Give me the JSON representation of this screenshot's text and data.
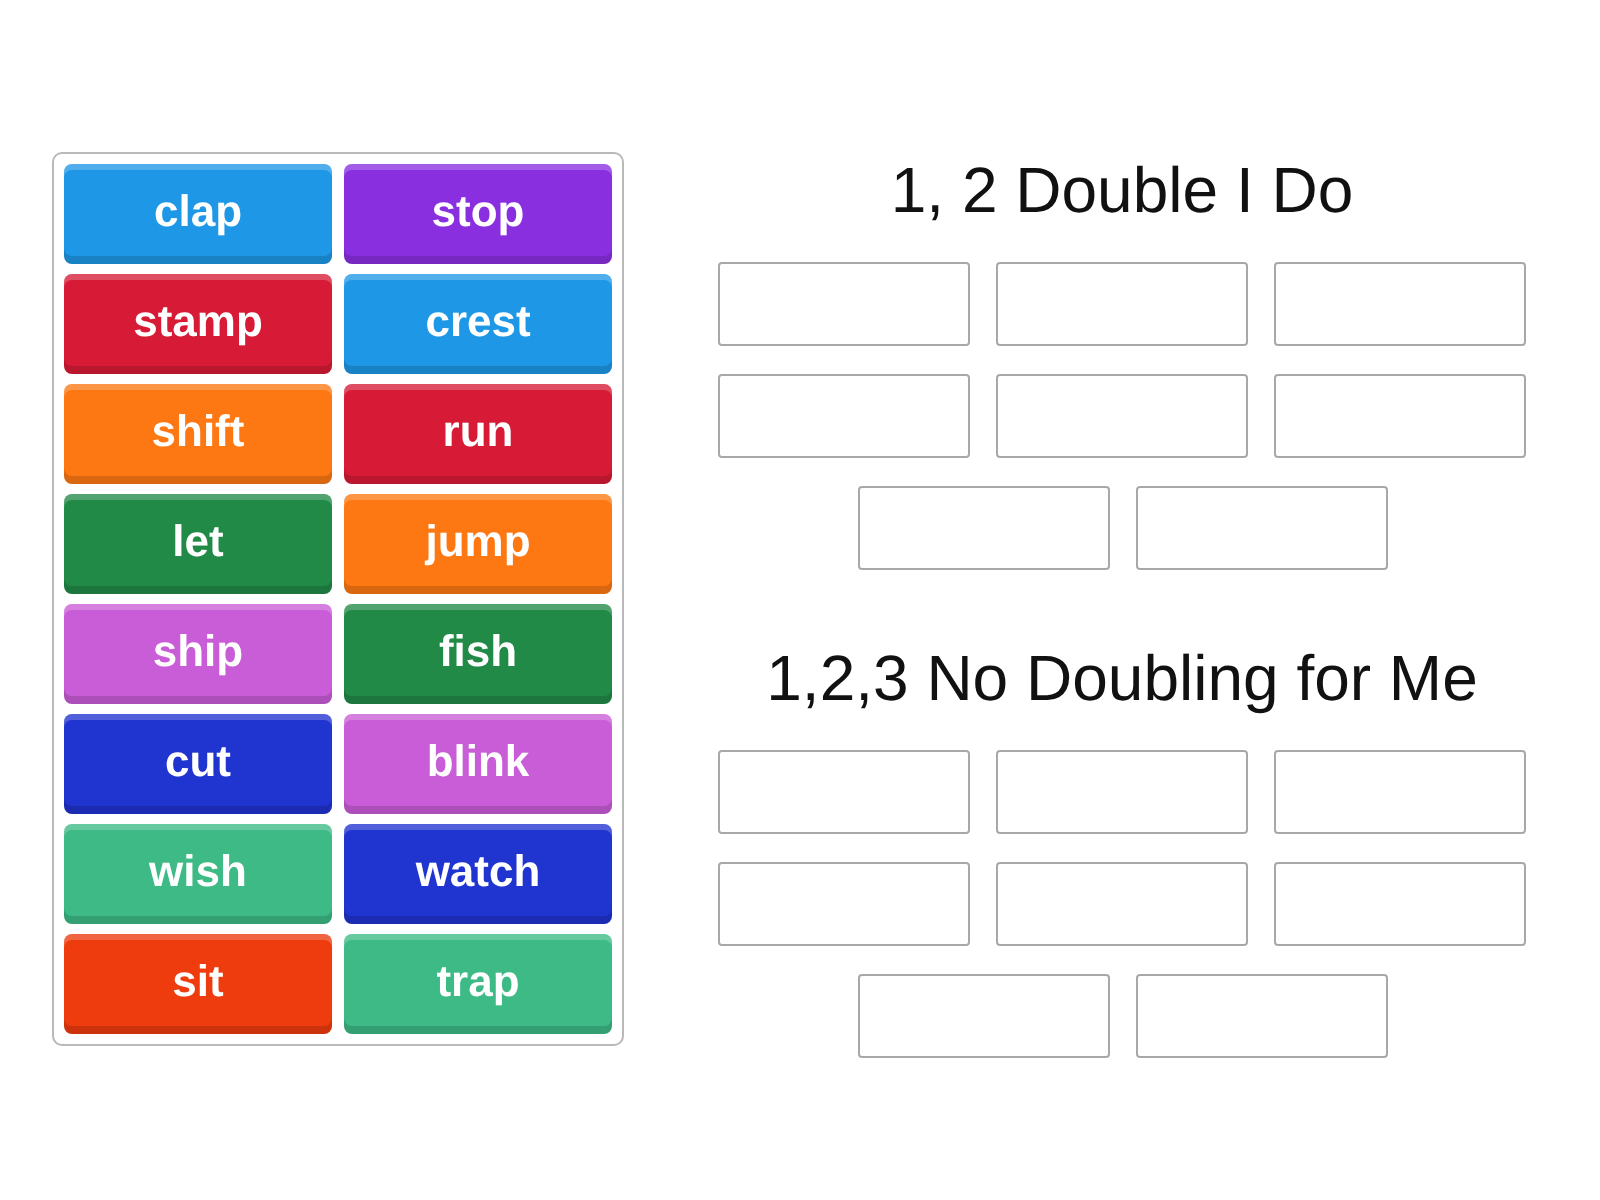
{
  "tiles": [
    {
      "word": "clap",
      "color": "#1e98e6"
    },
    {
      "word": "stop",
      "color": "#8a2fe0"
    },
    {
      "word": "stamp",
      "color": "#d71b36"
    },
    {
      "word": "crest",
      "color": "#1e98e6"
    },
    {
      "word": "shift",
      "color": "#fd7812"
    },
    {
      "word": "run",
      "color": "#d71b36"
    },
    {
      "word": "let",
      "color": "#228a47"
    },
    {
      "word": "jump",
      "color": "#fd7812"
    },
    {
      "word": "ship",
      "color": "#c95dd7"
    },
    {
      "word": "fish",
      "color": "#228a47"
    },
    {
      "word": "cut",
      "color": "#2034d0"
    },
    {
      "word": "blink",
      "color": "#c95dd7"
    },
    {
      "word": "wish",
      "color": "#3dba85"
    },
    {
      "word": "watch",
      "color": "#2034d0"
    },
    {
      "word": "sit",
      "color": "#ee3c0e"
    },
    {
      "word": "trap",
      "color": "#3dba85"
    }
  ],
  "groups": [
    {
      "title": "1, 2 Double I Do",
      "slots": [
        {
          "kind": "empty"
        },
        {
          "kind": "empty"
        },
        {
          "kind": "empty"
        },
        {
          "kind": "empty"
        },
        {
          "kind": "empty"
        },
        {
          "kind": "empty"
        },
        {
          "kind": "empty"
        },
        {
          "kind": "empty"
        }
      ]
    },
    {
      "title": "1,2,3 No Doubling for Me",
      "slots": [
        {
          "kind": "empty"
        },
        {
          "kind": "empty"
        },
        {
          "kind": "empty"
        },
        {
          "kind": "empty"
        },
        {
          "kind": "empty"
        },
        {
          "kind": "empty"
        },
        {
          "kind": "empty"
        },
        {
          "kind": "empty"
        }
      ]
    }
  ]
}
